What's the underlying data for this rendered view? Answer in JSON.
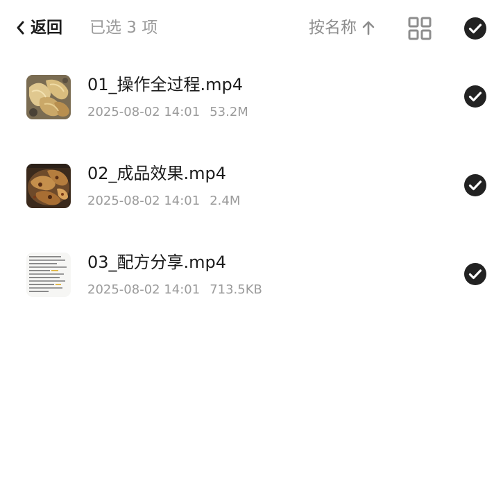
{
  "header": {
    "back_label": "返回",
    "selected_text": "已选 3 项",
    "sort_label": "按名称",
    "sort_direction_icon": "arrow-up-icon",
    "view_toggle_icon": "grid-view-icon",
    "select_all_icon": "check-circle-icon"
  },
  "files": [
    {
      "name": "01_操作全过程.mp4",
      "date": "2025-08-02 14:01",
      "size": "53.2M",
      "thumbnail": "food-photo-thumbnail",
      "selected": true
    },
    {
      "name": "02_成品效果.mp4",
      "date": "2025-08-02 14:01",
      "size": "2.4M",
      "thumbnail": "food-photo-thumbnail",
      "selected": true
    },
    {
      "name": "03_配方分享.mp4",
      "date": "2025-08-02 14:01",
      "size": "713.5KB",
      "thumbnail": "text-document-thumbnail",
      "selected": true
    }
  ],
  "colors": {
    "text_primary": "#1b1b1b",
    "text_secondary": "#9b9b9b",
    "check_fill": "#222222",
    "background": "#ffffff"
  }
}
